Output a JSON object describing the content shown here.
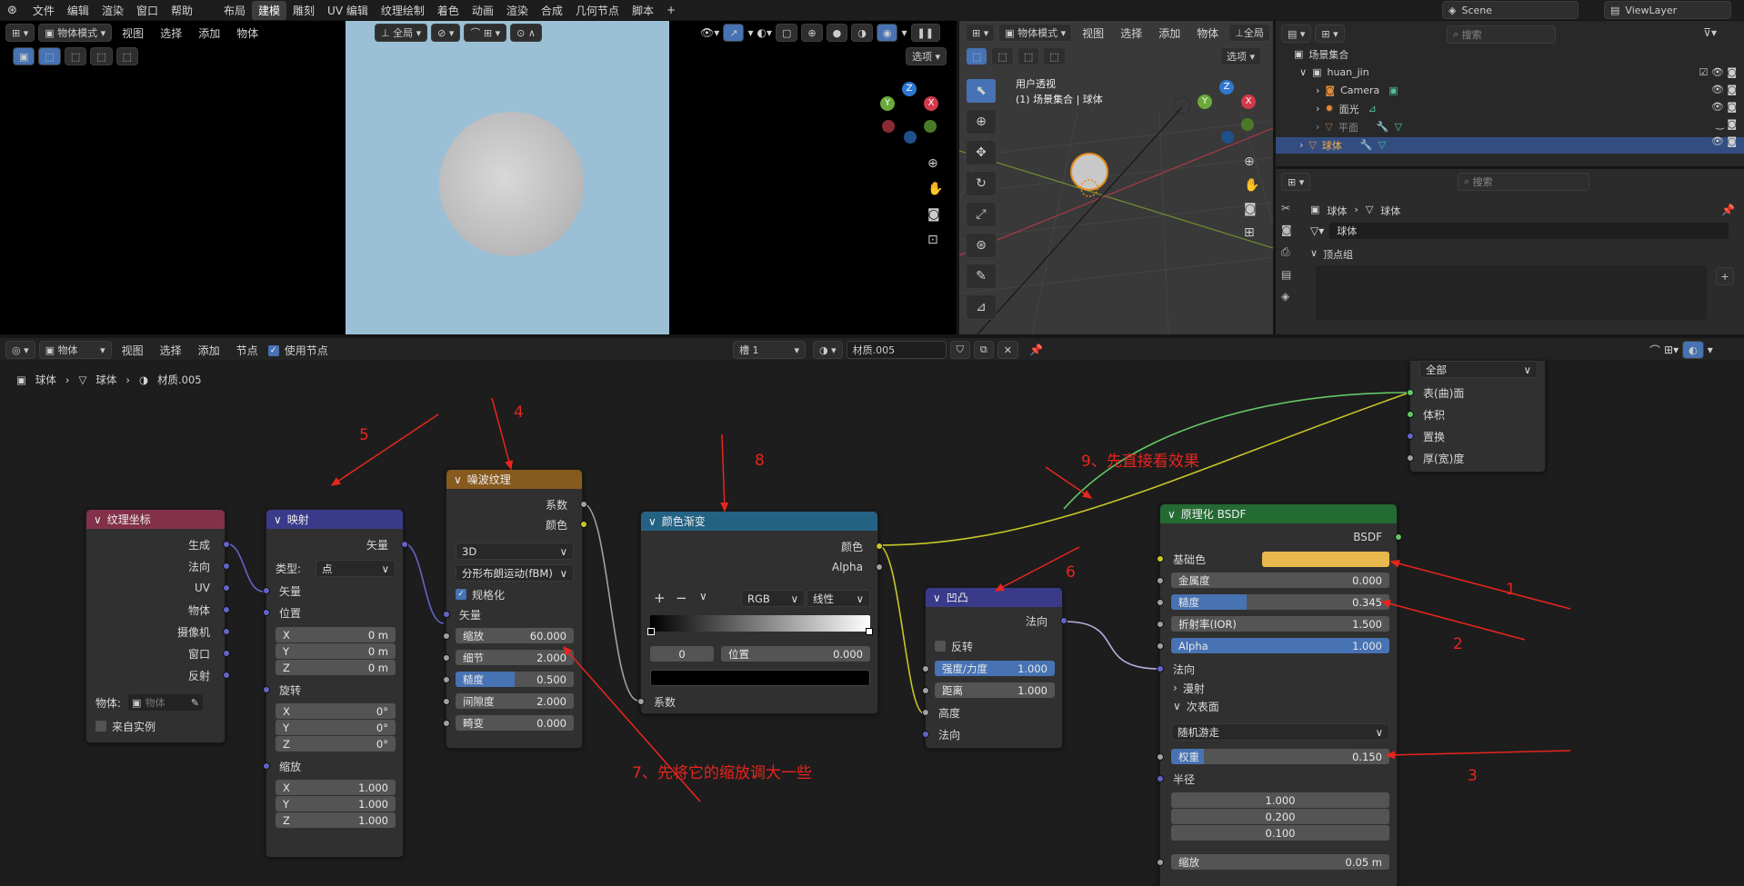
{
  "topbar": {
    "menus": [
      "文件",
      "编辑",
      "渲染",
      "窗口",
      "帮助"
    ],
    "workspaces": [
      "布局",
      "建模",
      "雕刻",
      "UV 编辑",
      "纹理绘制",
      "着色",
      "动画",
      "渲染",
      "合成",
      "几何节点",
      "脚本"
    ],
    "active_workspace": "建模",
    "scene": "Scene",
    "view_layer": "ViewLayer"
  },
  "viewport_left": {
    "mode": "物体模式",
    "menus": [
      "视图",
      "选择",
      "添加",
      "物体"
    ],
    "view": "全局",
    "options": "选项"
  },
  "viewport_right": {
    "mode": "物体模式",
    "menus": [
      "视图",
      "选择",
      "添加",
      "物体"
    ],
    "view": "全局",
    "options": "选项",
    "title_line1": "用户透视",
    "title_line2": "(1) 场景集合 | 球体",
    "gizmo": {
      "x": "X",
      "y": "Y",
      "z": "Z"
    }
  },
  "outliner": {
    "search_placeholder": "搜索",
    "root": "场景集合",
    "items": [
      "huan_jin",
      "Camera",
      "面光",
      "平面",
      "球体"
    ]
  },
  "properties": {
    "search_placeholder": "搜索",
    "breadcrumb": [
      "球体",
      "球体"
    ],
    "data_name": "球体",
    "panel": "顶点组"
  },
  "node_editor": {
    "mode": "物体",
    "menus": [
      "视图",
      "选择",
      "添加",
      "节点"
    ],
    "use_nodes_label": "使用节点",
    "slot": "槽 1",
    "material": "材质.005",
    "breadcrumb": [
      "球体",
      "球体",
      "材质.005"
    ]
  },
  "nodes": {
    "texcoord": {
      "title": "纹理坐标",
      "outputs": [
        "生成",
        "法向",
        "UV",
        "物体",
        "摄像机",
        "窗口",
        "反射"
      ],
      "object_label": "物体:",
      "object_placeholder": "物体",
      "from_instancer": "来自实例"
    },
    "mapping": {
      "title": "映射",
      "out": "矢量",
      "type_label": "类型:",
      "type_value": "点",
      "vector_in": "矢量",
      "location": "位置",
      "loc": [
        [
          "X",
          "0 m"
        ],
        [
          "Y",
          "0 m"
        ],
        [
          "Z",
          "0 m"
        ]
      ],
      "rotation": "旋转",
      "rot": [
        [
          "X",
          "0°"
        ],
        [
          "Y",
          "0°"
        ],
        [
          "Z",
          "0°"
        ]
      ],
      "scale": "缩放",
      "scl": [
        [
          "X",
          "1.000"
        ],
        [
          "Y",
          "1.000"
        ],
        [
          "Z",
          "1.000"
        ]
      ]
    },
    "noise": {
      "title": "噪波纹理",
      "outputs": [
        "系数",
        "颜色"
      ],
      "dim": "3D",
      "type": "分形布朗运动(fBM)",
      "normalize": "规格化",
      "vector": "矢量",
      "fields": [
        [
          "缩放",
          "60.000"
        ],
        [
          "细节",
          "2.000"
        ],
        [
          "糙度",
          "0.500"
        ],
        [
          "间隙度",
          "2.000"
        ],
        [
          "畸变",
          "0.000"
        ]
      ]
    },
    "ramp": {
      "title": "颜色渐变",
      "outputs": [
        "颜色",
        "Alpha"
      ],
      "mode": "RGB",
      "interp": "线性",
      "index": "0",
      "pos_label": "位置",
      "pos_value": "0.000",
      "input": "系数"
    },
    "bump": {
      "title": "凹凸",
      "out": "法向",
      "invert": "反转",
      "strength_label": "强度/力度",
      "strength": "1.000",
      "distance_label": "距离",
      "distance": "1.000",
      "height": "高度",
      "normal": "法向"
    },
    "bsdf": {
      "title": "原理化 BSDF",
      "out": "BSDF",
      "base_color": "基础色",
      "base_color_hex": "#e8b84c",
      "fields": [
        [
          "金属度",
          "0.000"
        ],
        [
          "糙度",
          "0.345"
        ],
        [
          "折射率(IOR)",
          "1.500"
        ],
        [
          "Alpha",
          "1.000"
        ]
      ],
      "normal": "法向",
      "diffuse": "漫射",
      "subsurface": "次表面",
      "method": "随机游走",
      "weight_label": "权重",
      "weight": "0.150",
      "radius": "半径",
      "radius_vals": [
        "1.000",
        "0.200",
        "0.100"
      ],
      "scale_label": "缩放",
      "scale": "0.05 m"
    },
    "output": {
      "target": "全部",
      "inputs": [
        "表(曲)面",
        "体积",
        "置换",
        "厚(宽)度"
      ]
    }
  },
  "annotations": {
    "a1": "1",
    "a2": "2",
    "a3": "3",
    "a4": "4",
    "a5": "5",
    "a6": "6",
    "a7": "7、先将它的缩放调大一些",
    "a8": "8",
    "a9": "9、先直接看效果"
  }
}
